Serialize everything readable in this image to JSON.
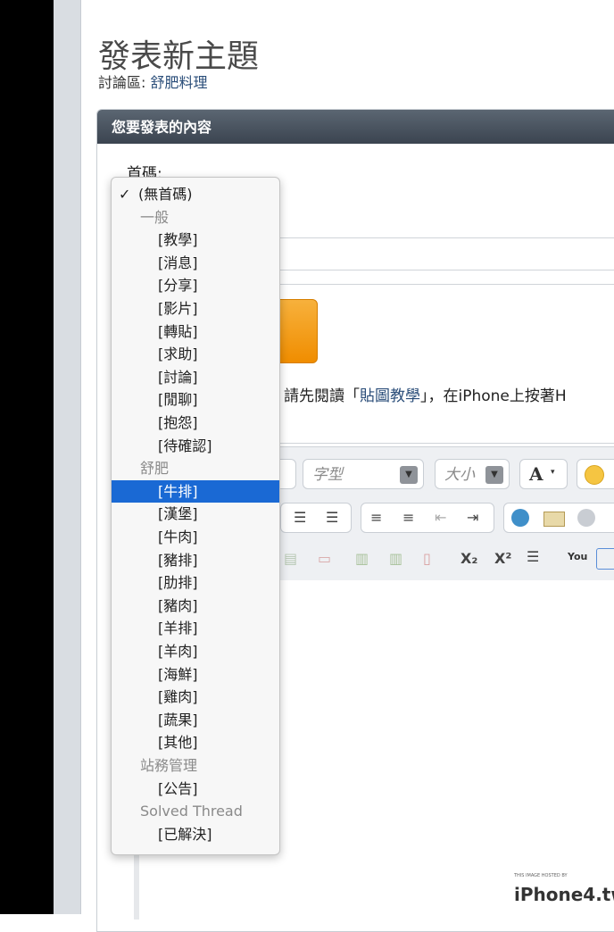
{
  "page": {
    "title": "發表新主題",
    "forum_label": "討論區: ",
    "forum_name": "舒肥料理"
  },
  "panel": {
    "header": "您要發表的內容",
    "prefix_label": "首碼:",
    "hint_prefix": "請先閱讀「",
    "hint_link": "貼圖教學",
    "hint_suffix": "」，在iPhone上按著H"
  },
  "toolbar": {
    "font_placeholder": "字型",
    "size_placeholder": "大小",
    "font_color_glyph": "A",
    "subscript": "X₂",
    "superscript": "X²",
    "youtube": "You"
  },
  "dropdown": {
    "checked_mark": "✓",
    "none_option": "(無首碼)",
    "groups": [
      {
        "label": "一般",
        "options": [
          "[教學]",
          "[消息]",
          "[分享]",
          "[影片]",
          "[轉貼]",
          "[求助]",
          "[討論]",
          "[閒聊]",
          "[抱怨]",
          "[待確認]"
        ]
      },
      {
        "label": "舒肥",
        "options": [
          "[牛排]",
          "[漢堡]",
          "[牛肉]",
          "[豬排]",
          "[肋排]",
          "[豬肉]",
          "[羊排]",
          "[羊肉]",
          "[海鮮]",
          "[雞肉]",
          "[蔬果]",
          "[其他]"
        ]
      },
      {
        "label": "站務管理",
        "options": [
          "[公告]"
        ]
      },
      {
        "label": "Solved Thread",
        "options": [
          "[已解決]"
        ]
      }
    ],
    "highlighted_option": "[牛排]"
  },
  "watermark": {
    "small": "THIS IMAGE HOSTED BY",
    "text": "iPhone4.tw"
  },
  "colors": {
    "highlight": "#1a69d4",
    "header_bg": "#3b4450",
    "link": "#2a4d79",
    "orange": "#f08d00"
  }
}
